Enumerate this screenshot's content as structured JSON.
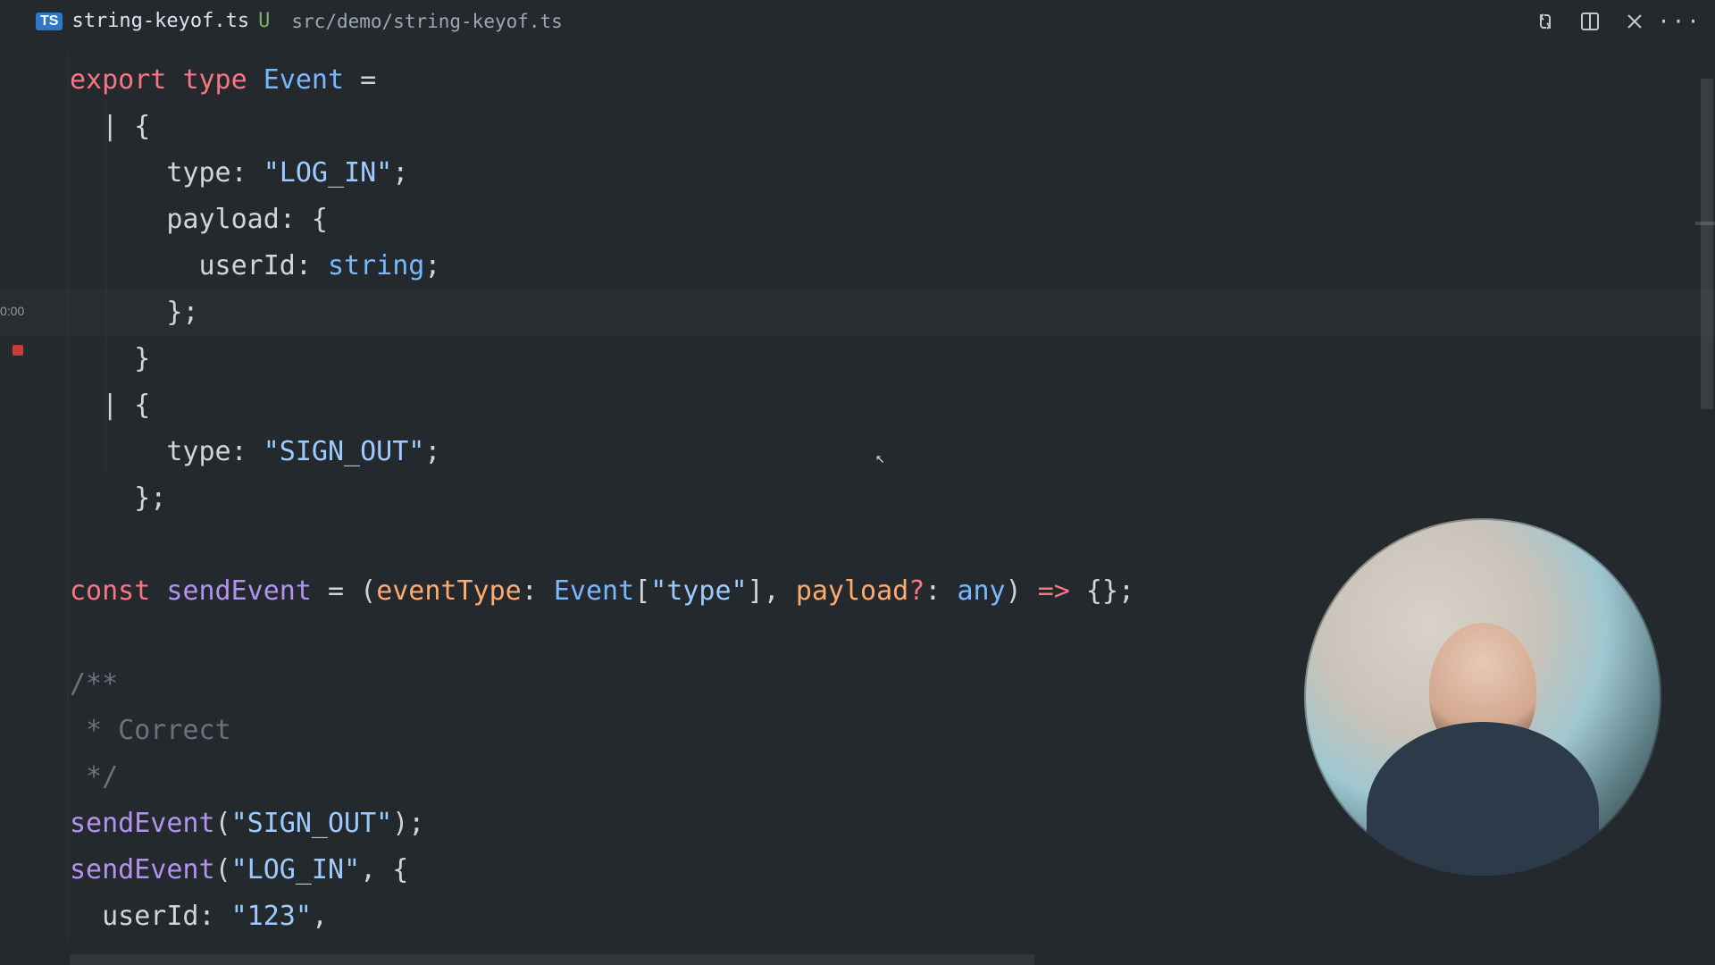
{
  "tab": {
    "language_badge": "TS",
    "filename": "string-keyof.ts",
    "git_status": "U",
    "breadcrumb": "src/demo/string-keyof.ts"
  },
  "side": {
    "timestamp": "0:00"
  },
  "code": {
    "l1_export": "export",
    "l1_type": "type",
    "l1_name": "Event",
    "l1_eq": " =",
    "l2": "  | {",
    "l3_key": "      type",
    "l3_colon": ": ",
    "l3_val": "\"LOG_IN\"",
    "l3_semi": ";",
    "l4_key": "      payload",
    "l4_rest": ": {",
    "l5_key": "        userId",
    "l5_colon": ": ",
    "l5_type": "string",
    "l5_semi": ";",
    "l6": "      };",
    "l7": "    }",
    "l8": "  | {",
    "l9_key": "      type",
    "l9_colon": ": ",
    "l9_val": "\"SIGN_OUT\"",
    "l9_semi": ";",
    "l10": "    };",
    "l12_const": "const",
    "l12_name": " sendEvent",
    "l12_eq": " = (",
    "l12_p1": "eventType",
    "l12_p1t_a": ": ",
    "l12_p1t_b": "Event",
    "l12_p1t_c": "[",
    "l12_p1t_d": "\"type\"",
    "l12_p1t_e": "], ",
    "l12_p2": "payload",
    "l12_p2q": "?",
    "l12_p2t_a": ": ",
    "l12_p2t_b": "any",
    "l12_end_a": ") ",
    "l12_arrow": "=>",
    "l12_end_b": " {};",
    "c1": "/**",
    "c2": " * Correct",
    "c3": " */",
    "l16_fn": "sendEvent",
    "l16_open": "(",
    "l16_arg": "\"SIGN_OUT\"",
    "l16_close": ");",
    "l17_fn": "sendEvent",
    "l17_open": "(",
    "l17_arg": "\"LOG_IN\"",
    "l17_rest": ", {",
    "l18_key": "  userId",
    "l18_colon": ": ",
    "l18_val": "\"123\"",
    "l18_comma": ","
  }
}
